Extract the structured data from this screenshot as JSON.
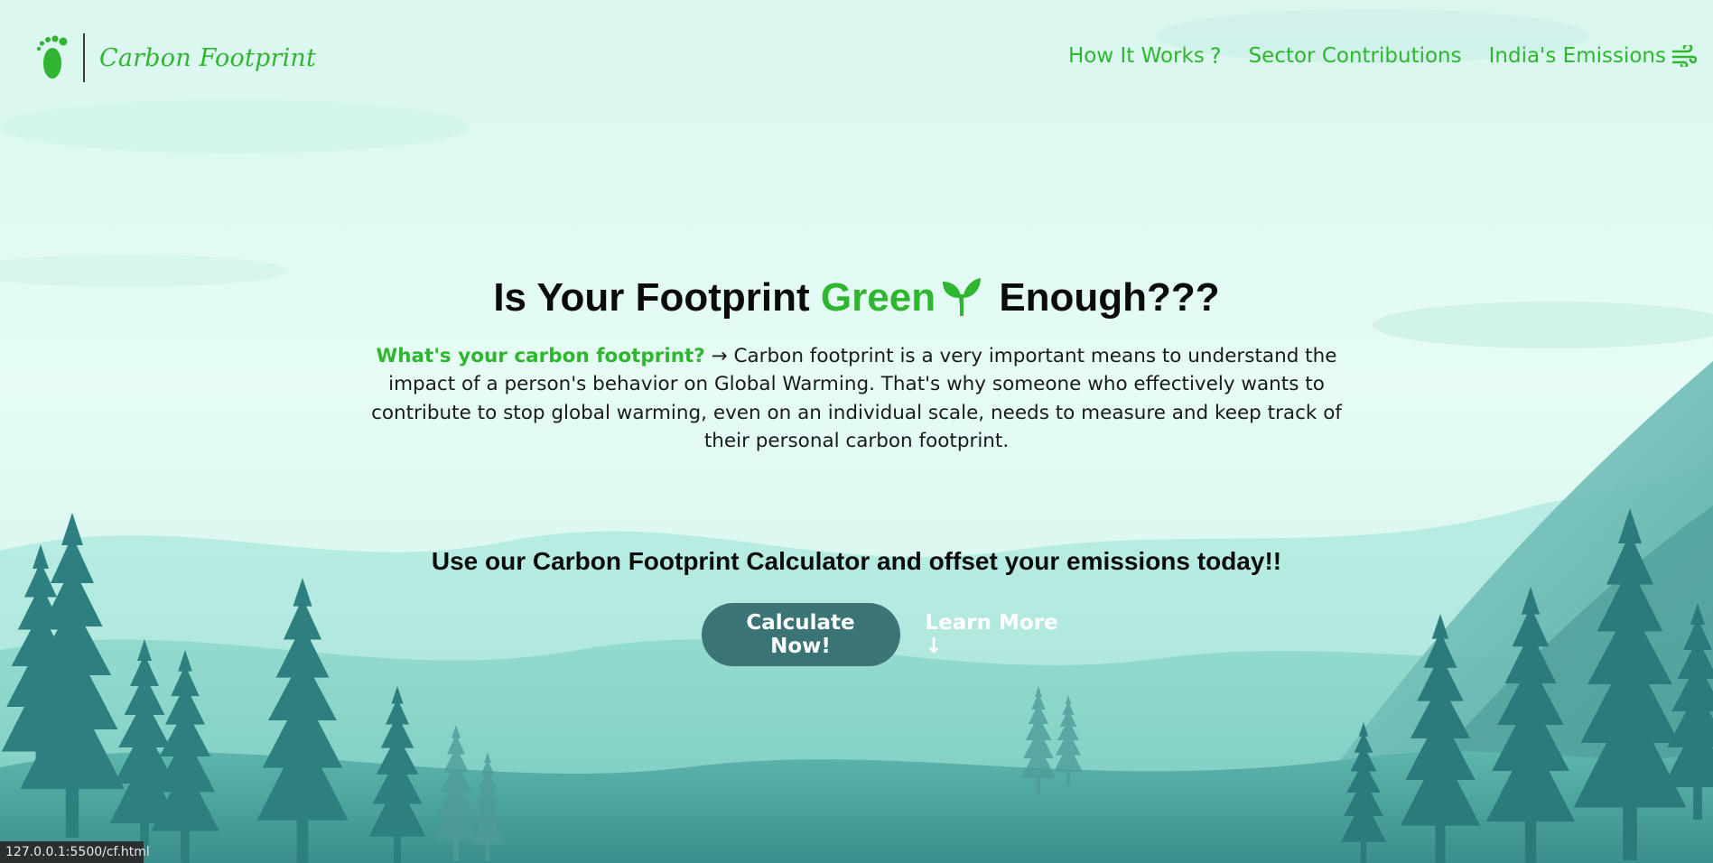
{
  "brand": {
    "name": "Carbon Footprint",
    "icon": "footprint-icon",
    "color": "#31b531"
  },
  "nav": [
    {
      "label": "How It Works",
      "icon": "question-icon",
      "glyph": "?"
    },
    {
      "label": "Sector Contributions",
      "icon": "",
      "glyph": ""
    },
    {
      "label": "India's Emissions",
      "icon": "wind-icon",
      "glyph": ""
    }
  ],
  "hero": {
    "title_before": "Is Your Footprint",
    "title_green": "Green",
    "title_after": "Enough???",
    "title_icon": "sprout-icon",
    "intro_question": "What's your carbon footprint?",
    "intro_arrow": "→",
    "intro_body": "Carbon footprint is a very important means to understand the impact of a person's behavior on Global Warming. That's why someone who effectively wants to contribute to stop global warming, even on an individual scale, needs to measure and keep track of their personal carbon footprint."
  },
  "cta": {
    "text": "Use our Carbon Footprint Calculator and offset your emissions today!!",
    "primary_label": "Calculate Now!",
    "secondary_label": "Learn More ↓"
  },
  "status_bar": {
    "url": "127.0.0.1:5500/cf.html"
  },
  "colors": {
    "accent": "#2fb62f",
    "button": "#3b7474",
    "background": "#e3fbf4"
  }
}
